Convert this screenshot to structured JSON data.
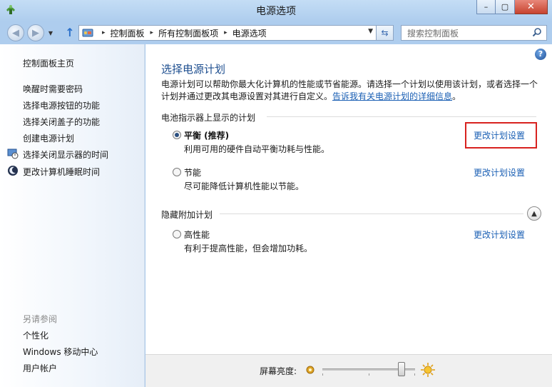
{
  "window": {
    "title": "电源选项"
  },
  "address": {
    "crumbs": [
      "控制面板",
      "所有控制面板项",
      "电源选项"
    ],
    "search_placeholder": "搜索控制面板"
  },
  "sidebar": {
    "home": "控制面板主页",
    "items": [
      "唤醒时需要密码",
      "选择电源按钮的功能",
      "选择关闭盖子的功能",
      "创建电源计划",
      "选择关闭显示器的时间",
      "更改计算机睡眠时间"
    ],
    "see_also_title": "另请参阅",
    "see_also": [
      "个性化",
      "Windows 移动中心",
      "用户帐户"
    ]
  },
  "main": {
    "title": "选择电源计划",
    "description": "电源计划可以帮助你最大化计算机的性能或节省能源。请选择一个计划以使用该计划，或者选择一个计划并通过更改其电源设置对其进行自定义。",
    "description_link": "告诉我有关电源计划的详细信息",
    "description_end": "。",
    "group_battery": "电池指示器上显示的计划",
    "group_hidden": "隐藏附加计划",
    "plans": [
      {
        "name": "平衡 (推荐)",
        "desc": "利用可用的硬件自动平衡功耗与性能。",
        "link": "更改计划设置",
        "selected": true
      },
      {
        "name": "节能",
        "desc": "尽可能降低计算机性能以节能。",
        "link": "更改计划设置",
        "selected": false
      },
      {
        "name": "高性能",
        "desc": "有利于提高性能，但会增加功耗。",
        "link": "更改计划设置",
        "selected": false
      }
    ]
  },
  "footer": {
    "brightness_label": "屏幕亮度:",
    "brightness_level": 0.85
  },
  "colors": {
    "link": "#1a5fb4",
    "title": "#1d4e8f",
    "highlight": "#d8221f"
  }
}
